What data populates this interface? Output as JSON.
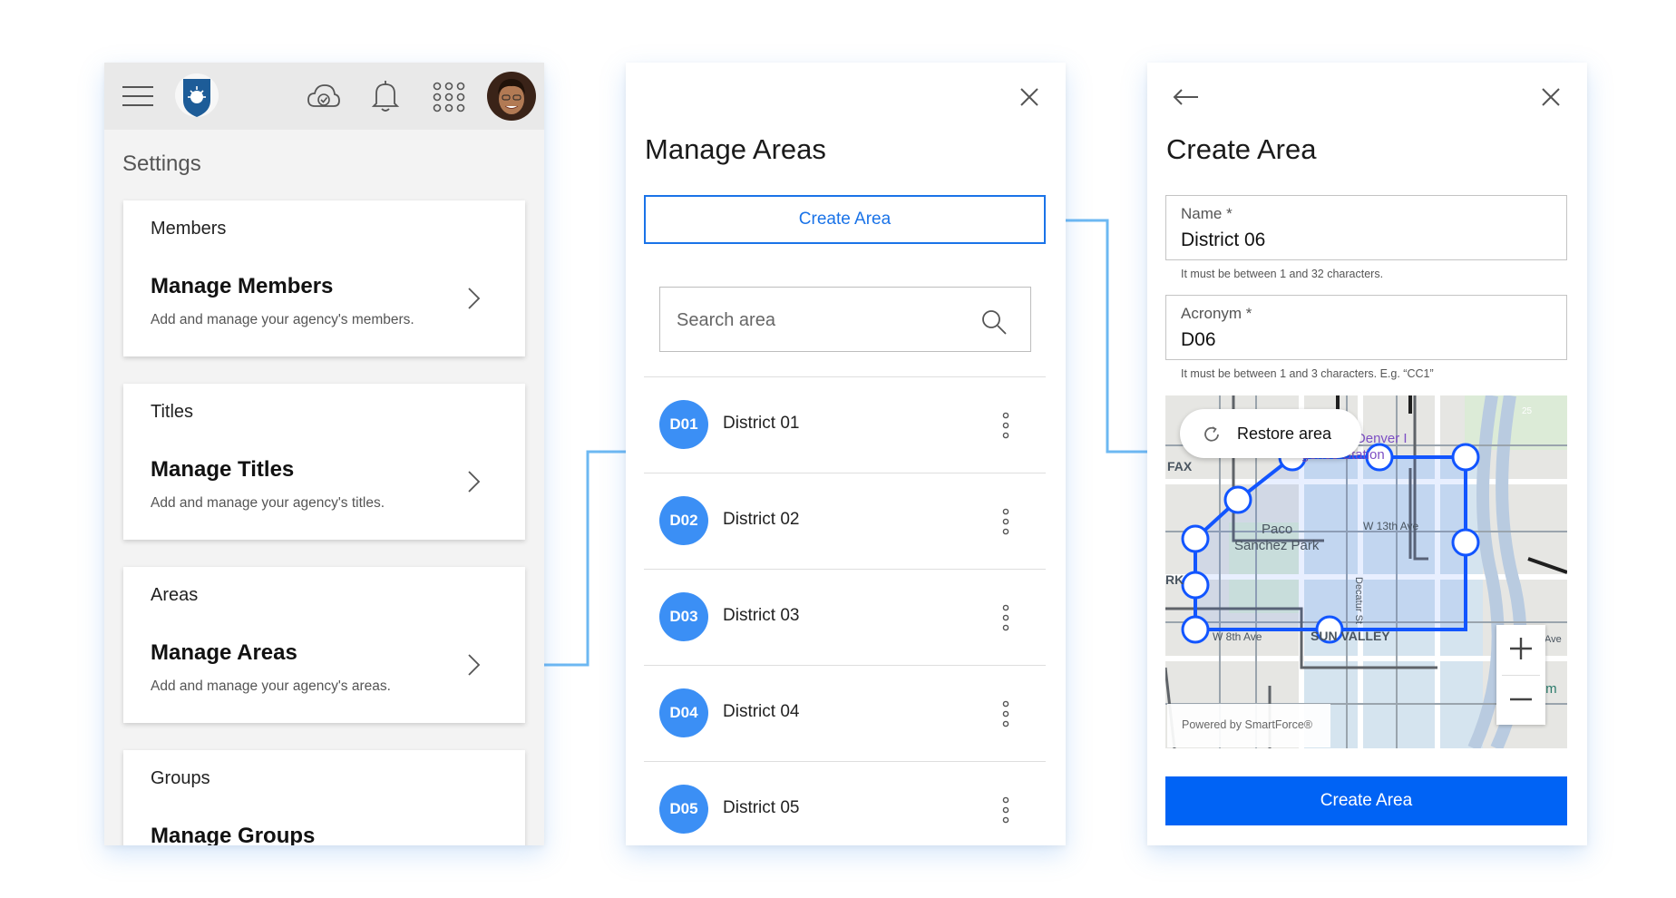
{
  "colors": {
    "accent": "#1a73e8",
    "primary_button": "#0063f5",
    "badge": "#3b8ff5",
    "connector": "#6db8f2"
  },
  "settings_panel": {
    "title": "Settings",
    "topbar_icons": [
      "menu-icon",
      "agency-shield-logo",
      "cloud-sync-icon",
      "bell-icon",
      "apps-grid-icon",
      "user-avatar"
    ],
    "cards": [
      {
        "category": "Members",
        "title": "Manage Members",
        "description": "Add and manage your agency's members."
      },
      {
        "category": "Titles",
        "title": "Manage Titles",
        "description": "Add and manage your agency's titles."
      },
      {
        "category": "Areas",
        "title": "Manage Areas",
        "description": "Add and manage your agency's areas."
      },
      {
        "category": "Groups",
        "title": "Manage Groups",
        "description": ""
      }
    ]
  },
  "manage_areas_panel": {
    "title": "Manage Areas",
    "create_button": "Create Area",
    "search_placeholder": "Search area",
    "areas": [
      {
        "acronym": "D01",
        "name": "District 01"
      },
      {
        "acronym": "D02",
        "name": "District 02"
      },
      {
        "acronym": "D03",
        "name": "District 03"
      },
      {
        "acronym": "D04",
        "name": "District 04"
      },
      {
        "acronym": "D05",
        "name": "District 05"
      }
    ]
  },
  "create_area_panel": {
    "title": "Create Area",
    "name_field": {
      "label": "Name *",
      "value": "District 06",
      "hint": "It must be between 1 and 32 characters."
    },
    "acronym_field": {
      "label": "Acronym *",
      "value": "D06",
      "hint": "It must be between 1 and 3 characters. E.g. “CC1”"
    },
    "map": {
      "restore_label": "Restore area",
      "powered_by": "Powered by SmartForce®",
      "labels": [
        "Wolf Denver I",
        "gence Station",
        "FAX",
        "Paco",
        "Sanchez Park",
        "W 13th Ave",
        "RK",
        "W 8th Ave",
        "SUN VALLEY",
        "Decatur St",
        "Ave",
        "ovem",
        "25"
      ]
    },
    "submit_button": "Create Area"
  }
}
